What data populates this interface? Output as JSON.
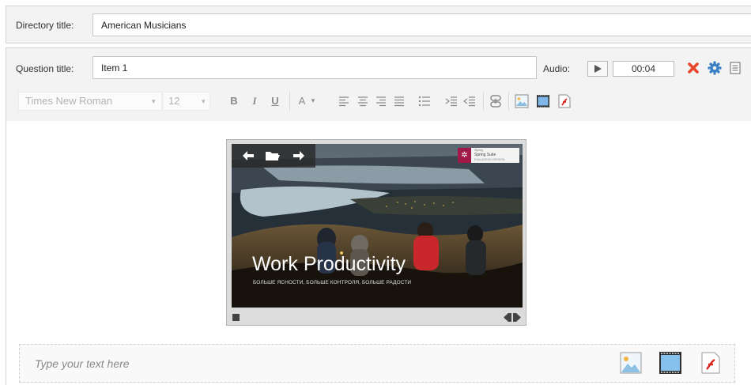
{
  "directory": {
    "label": "Directory title:",
    "value": "American Musicians"
  },
  "question": {
    "label": "Question title:",
    "value": "Item 1",
    "audio_label": "Audio:",
    "audio_time": "00:04"
  },
  "toolbar": {
    "font_family": "Times New Roman",
    "font_size": "12",
    "bold": "B",
    "italic": "I",
    "underline": "U",
    "font_color": "A"
  },
  "slide": {
    "title": "Work Productivity",
    "subtitle": "БОЛЬШЕ ЯСНОСТИ, БОЛЬШЕ КОНТРОЛЯ, БОЛЬШЕ РАДОСТИ",
    "logo_line1": "iSpring",
    "logo_line2": "Spring Suite",
    "logo_line3": "EVALUATION VERSION"
  },
  "editor": {
    "placeholder": "Type your text here"
  },
  "colors": {
    "delete_red": "#e8462a",
    "settings_blue": "#3b7fc4",
    "logo_magenta": "#a11949",
    "panel_bg": "#f3f3f3"
  }
}
